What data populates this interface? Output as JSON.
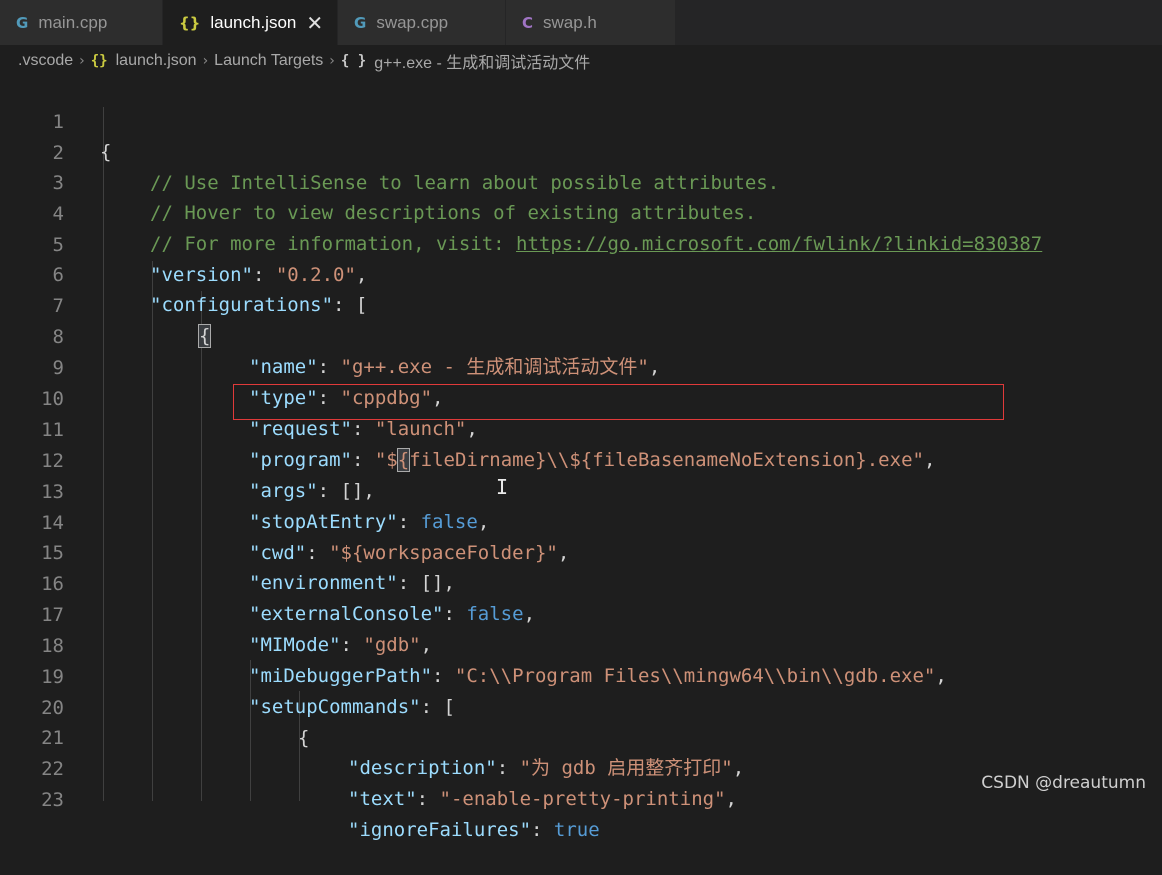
{
  "tabs": [
    {
      "label": "main.cpp",
      "icon": "cpp-file-icon",
      "glyph": "G",
      "active": false
    },
    {
      "label": "launch.json",
      "icon": "json-file-icon",
      "glyph": "{}",
      "active": true,
      "close": "✕"
    },
    {
      "label": "swap.cpp",
      "icon": "cpp-file-icon",
      "glyph": "G",
      "active": false
    },
    {
      "label": "swap.h",
      "icon": "c-header-icon",
      "glyph": "C",
      "active": false
    }
  ],
  "breadcrumb": {
    "folder": ".vscode",
    "file_glyph": "{}",
    "file": "launch.json",
    "section": "Launch Targets",
    "item_glyph": "{ }",
    "item": "g++.exe - 生成和调试活动文件",
    "sep": "›"
  },
  "line_numbers": [
    "1",
    "2",
    "3",
    "4",
    "5",
    "6",
    "7",
    "8",
    "9",
    "10",
    "11",
    "12",
    "13",
    "14",
    "15",
    "16",
    "17",
    "18",
    "19",
    "20",
    "21",
    "22",
    "23"
  ],
  "code": {
    "l1": "{",
    "l2": "// Use IntelliSense to learn about possible attributes.",
    "l3": "// Hover to view descriptions of existing attributes.",
    "l4_prefix": "// For more information, visit: ",
    "l4_url": "https://go.microsoft.com/fwlink/?linkid=830387",
    "version_key": "\"version\"",
    "version_val": "\"0.2.0\"",
    "configurations_key": "\"configurations\"",
    "open_bracket": "[",
    "open_brace": "{",
    "name_key": "\"name\"",
    "name_val": "\"g++.exe - 生成和调试活动文件\"",
    "type_key": "\"type\"",
    "type_val": "\"cppdbg\"",
    "request_key": "\"request\"",
    "request_val": "\"launch\"",
    "program_key": "\"program\"",
    "program_val_a": "\"$",
    "program_val_b": "{",
    "program_val_c": "fileDirname}\\\\${fileBasenameNoExtension}.exe\"",
    "args_key": "\"args\"",
    "args_val": "[]",
    "stopAtEntry_key": "\"stopAtEntry\"",
    "stopAtEntry_val": "false",
    "cwd_key": "\"cwd\"",
    "cwd_val": "\"${workspaceFolder}\"",
    "environment_key": "\"environment\"",
    "environment_val": "[]",
    "externalConsole_key": "\"externalConsole\"",
    "externalConsole_val": "false",
    "MIMode_key": "\"MIMode\"",
    "MIMode_val": "\"gdb\"",
    "miDebuggerPath_key": "\"miDebuggerPath\"",
    "miDebuggerPath_val": "\"C:\\\\Program Files\\\\mingw64\\\\bin\\\\gdb.exe\"",
    "setupCommands_key": "\"setupCommands\"",
    "description_key": "\"description\"",
    "description_val": "\"为 gdb 启用整齐打印\"",
    "text_key": "\"text\"",
    "text_val": "\"-enable-pretty-printing\"",
    "ignoreFailures_key": "\"ignoreFailures\"",
    "ignoreFailures_val": "true",
    "colon": ": ",
    "comma": ","
  },
  "cursor_glyph": "I",
  "watermark": "CSDN @dreautumn",
  "colors": {
    "background": "#1e1e1e",
    "key": "#9cdcfe",
    "string": "#ce9178",
    "comment": "#6a9955",
    "boolean": "#569cd6",
    "highlight_border": "#e03a3a"
  }
}
